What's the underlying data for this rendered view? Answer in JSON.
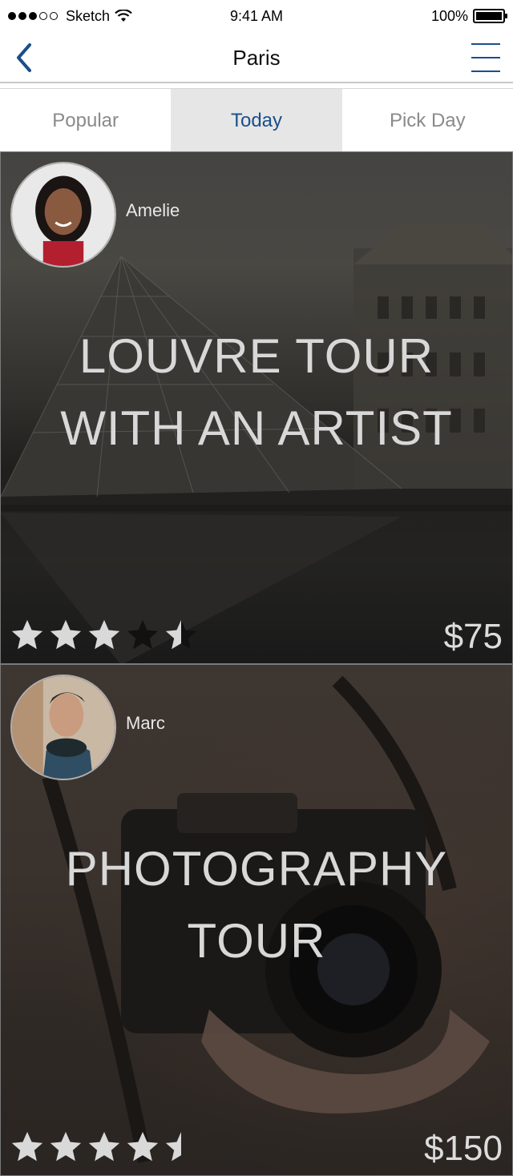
{
  "status_bar": {
    "carrier": "Sketch",
    "time": "9:41 AM",
    "battery": "100%"
  },
  "nav": {
    "title": "Paris",
    "back_icon": "chevron-left-icon",
    "menu_icon": "hamburger-menu-icon",
    "accent_color": "#1a4f8a"
  },
  "tabs": [
    {
      "label": "Popular",
      "active": false
    },
    {
      "label": "Today",
      "active": true
    },
    {
      "label": "Pick Day",
      "active": false
    }
  ],
  "tours": [
    {
      "host": "Amelie",
      "title_line1": "LOUVRE TOUR",
      "title_line2": "WITH AN ARTIST",
      "price": "$75",
      "rating": 3.5,
      "rating_max": 5
    },
    {
      "host": "Marc",
      "title_line1": "PHOTOGRAPHY",
      "title_line2": "TOUR",
      "price": "$150",
      "rating": 4.5,
      "rating_max": 5
    }
  ]
}
